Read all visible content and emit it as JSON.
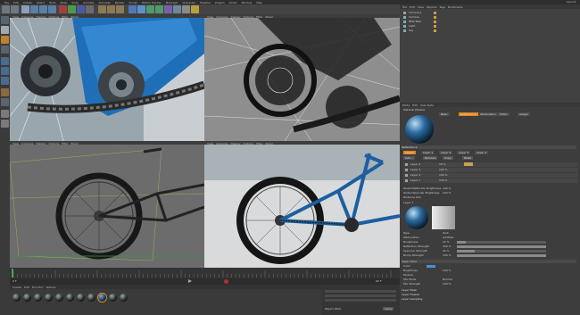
{
  "menu": [
    "File",
    "Edit",
    "Create",
    "Select",
    "Tools",
    "Mesh",
    "Snap",
    "Animate",
    "Simulate",
    "Render",
    "Sculpt",
    "Motion Tracker",
    "MoGraph",
    "Character",
    "Pipeline",
    "Plugins",
    "Script",
    "Window",
    "Help"
  ],
  "layout_label": "Layout:",
  "viewport_menu": [
    "View",
    "Cameras",
    "Display",
    "Options",
    "Filter",
    "Panel"
  ],
  "objects": {
    "menu": [
      "File",
      "Edit",
      "View",
      "Objects",
      "Tags",
      "Bookmarks"
    ],
    "items": [
      "Camera.1",
      "Camera",
      "BMX Bike",
      "Light",
      "Sky"
    ]
  },
  "material_editor": {
    "menu": [
      "Mode",
      "Edit",
      "User Data"
    ],
    "material_label": "Material [Metal]",
    "tabs": [
      "Basic",
      "Reflectance",
      "Illumination",
      "Editor",
      "Assign"
    ],
    "section": "Reflectance",
    "layer_tabs": [
      "Layers",
      "Layer 1",
      "Layer 2",
      "Layer 3",
      "Layer 4"
    ],
    "layer_buttons": [
      "Add...",
      "Remove",
      "Copy",
      "Paste"
    ],
    "layers": [
      "Layer 4",
      "Layer 3",
      "Layer 2",
      "Layer 1"
    ],
    "layer_values": [
      "18 %",
      "100 %",
      "100 %",
      "100 %"
    ],
    "global_reflection_label": "Global Reflection Brightness",
    "global_reflection_value": "100 %",
    "global_specular_label": "Global Specular Brightness",
    "global_specular_value": "100 %",
    "distance_dim_label": "Distance Dim",
    "layer1_label": "Layer 1",
    "type_label": "Type",
    "type_value": "GGX",
    "attenuation_label": "Attenuation",
    "attenuation_value": "Additive",
    "roughness_label": "Roughness",
    "roughness_value": "10 %",
    "reflection_strength_label": "Reflection Strength",
    "reflection_strength_value": "100 %",
    "specular_strength_label": "Specular Strength",
    "specular_strength_value": "20 %",
    "bump_strength_label": "Bump Strength",
    "bump_strength_value": "100 %",
    "layer_color_label": "Layer Color",
    "color_label": "Color",
    "brightness_label": "Brightness",
    "brightness_value": "100 %",
    "texture_label": "Texture",
    "mix_mode_label": "Mix Mode",
    "mix_mode_value": "Normal",
    "mix_strength_label": "Mix Strength",
    "mix_strength_value": "100 %",
    "layer_mask_label": "Layer Mask",
    "layer_fresnel_label": "Layer Fresnel",
    "layer_sampling_label": "Layer Sampling",
    "accent": "#e0861a"
  },
  "materials": {
    "menu": [
      "Create",
      "Edit",
      "Function",
      "Texture"
    ]
  },
  "timeline": {
    "start_frame": "0 F",
    "end_frame": "90 F"
  },
  "coordinates": {
    "apply_label": "Apply",
    "mode_label": "Object (Rel)"
  }
}
